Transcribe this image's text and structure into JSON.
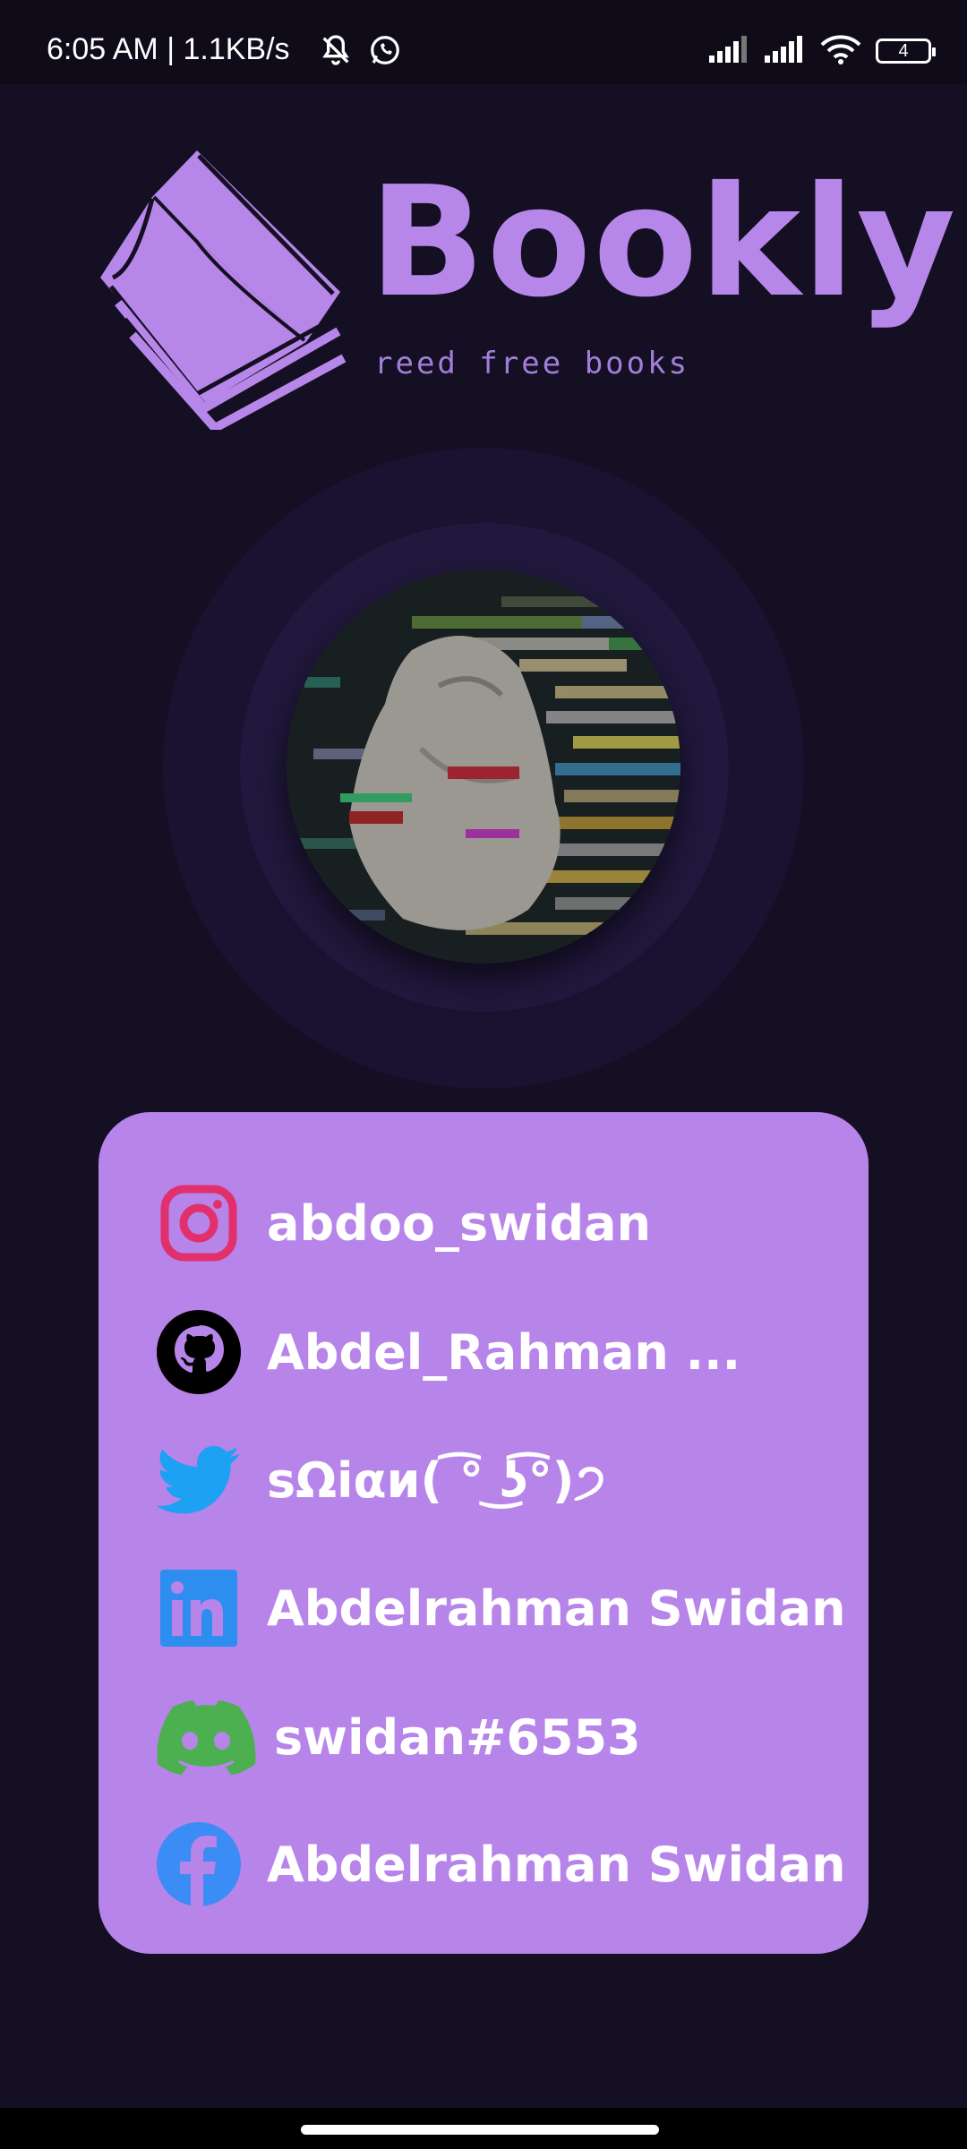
{
  "status_bar": {
    "time": "6:05 AM | 1.1KB/s",
    "battery_level": "4",
    "icons": [
      "mute-bell-icon",
      "whatsapp-icon",
      "signal-icon",
      "signal-icon",
      "wifi-icon",
      "battery-icon"
    ]
  },
  "logo": {
    "title": "Bookly",
    "tagline": "reed free books",
    "icon": "book-icon",
    "color": "#b786e9"
  },
  "profile": {
    "avatar": "profile-avatar"
  },
  "socials": [
    {
      "platform": "instagram",
      "icon": "instagram-icon",
      "label": "abdoo_swidan"
    },
    {
      "platform": "github",
      "icon": "github-icon",
      "label": "Abdel_Rahman ..."
    },
    {
      "platform": "twitter",
      "icon": "twitter-icon",
      "label": "sΩi⁠αи( ͡° ͜ʖ͡°)੭"
    },
    {
      "platform": "linkedin",
      "icon": "linkedin-icon",
      "label": "Abdelrahman Swidan"
    },
    {
      "platform": "discord",
      "icon": "discord-icon",
      "label": "swidan#6553"
    },
    {
      "platform": "facebook",
      "icon": "facebook-icon",
      "label": "Abdelrahman Swidan"
    }
  ],
  "colors": {
    "background": "#140f23",
    "card": "#b784e9",
    "accent": "#b786e9",
    "instagram": "#e1306c",
    "twitter": "#1da1f2",
    "linkedin": "#2d8ef0",
    "discord": "#4caf50",
    "facebook": "#3b8cf4"
  }
}
